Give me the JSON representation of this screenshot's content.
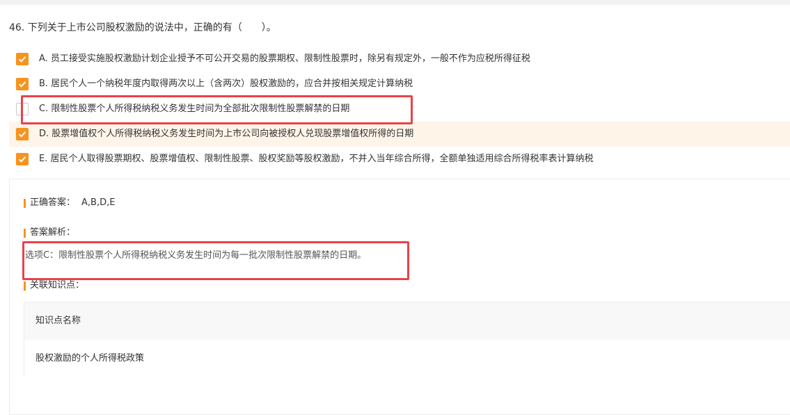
{
  "question": {
    "text": "46. 下列关于上市公司股权激励的说法中，正确的有（　　）。"
  },
  "options": [
    {
      "label": "A. 员工接受实施股权激励计划企业授予不可公开交易的股票期权、限制性股票时，除另有规定外，一般不作为应税所得征税",
      "checked": true,
      "highlighted": false
    },
    {
      "label": "B. 居民个人一个纳税年度内取得两次以上（含两次）股权激励的，应合并按相关规定计算纳税",
      "checked": true,
      "highlighted": false
    },
    {
      "label": "C. 限制性股票个人所得税纳税义务发生时间为全部批次限制性股票解禁的日期",
      "checked": false,
      "highlighted": false
    },
    {
      "label": "D. 股票增值权个人所得税纳税义务发生时间为上市公司向被授权人兑现股票增值权所得的日期",
      "checked": true,
      "highlighted": true
    },
    {
      "label": "E. 居民个人取得股票期权、股票增值权、限制性股票、股权奖励等股权激励，不并入当年综合所得，全额单独适用综合所得税率表计算纳税",
      "checked": true,
      "highlighted": false
    }
  ],
  "answer": {
    "label": "正确答案：",
    "value": "A,B,D,E"
  },
  "analysis": {
    "label": "答案解析：",
    "text": "选项C：限制性股票个人所得税纳税义务发生时间为每一批次限制性股票解禁的日期。"
  },
  "knowledge": {
    "label": "关联知识点：",
    "column_header": "知识点名称",
    "rows": [
      "股权激励的个人所得税政策"
    ]
  },
  "colors": {
    "accent": "#f7931e",
    "highlight_bg": "#fef4e8",
    "annotation_red": "#e8424a"
  }
}
